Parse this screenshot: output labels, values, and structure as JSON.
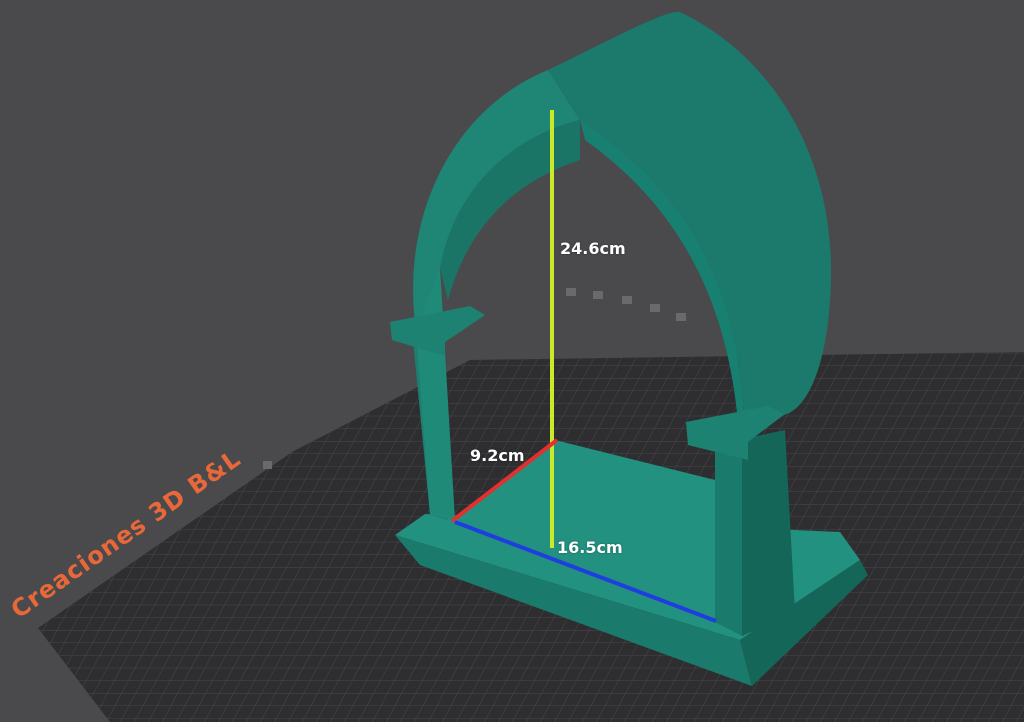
{
  "scene": {
    "background_color": "#4a4a4d",
    "bed_color": "#2e2e31",
    "grid_color": "#4c4c50",
    "model_color": "#1f8574",
    "model_shadow_color": "#16675a"
  },
  "dimensions": {
    "height": {
      "label": "24.6cm",
      "color": "#c8ea2a"
    },
    "depth": {
      "label": "9.2cm",
      "color": "#e3302e"
    },
    "width": {
      "label": "16.5cm",
      "color": "#1f3ee0"
    }
  },
  "watermark": {
    "text": "Creaciones 3D B&L",
    "color": "#e8683a"
  }
}
